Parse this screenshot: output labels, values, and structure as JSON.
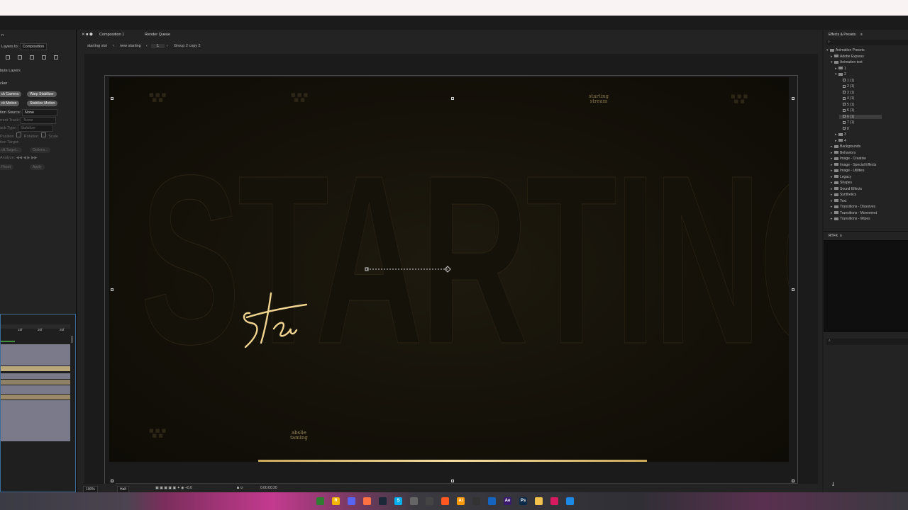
{
  "left_panel": {
    "align_label": "Layers to:",
    "align_value": "Composition",
    "distribute_label": "bute Layers",
    "tracker_title": "cker",
    "buttons": [
      "ck Camera",
      "Warp Stabilizer",
      "ck Motion",
      "Stabilize Motion"
    ],
    "motion_source_label": "tion Source:",
    "motion_source_value": "None",
    "current_track_label": "rrent Track:",
    "current_track_value": "None",
    "track_type_label": "ack Type:",
    "track_type_value": "Stabilize",
    "position_label": "Position",
    "rotation_label": "Rotation",
    "scale_label": "Scale",
    "motion_target_label": "tion Target:",
    "edit_target_label": "dit Target...",
    "options_label": "Options...",
    "analyze_label": "Analyze:",
    "reset_label": "Reset",
    "apply_label": "Apply",
    "timeline_ticks": [
      "15f",
      "20f",
      "25f"
    ]
  },
  "comp": {
    "tabs": [
      "Composition 1",
      "Render Queue"
    ],
    "breadcrumbs": [
      "starting stsi",
      "new starting",
      "1",
      "Group 2 copy 2"
    ],
    "canvas_word": "STARTING",
    "signature": "sta",
    "logo_top_right": [
      "starting",
      "stream"
    ],
    "logo_bottom_center": [
      "abslie",
      "taming"
    ],
    "view_zoom": "100%",
    "view_resolution": "Half",
    "view_timecode": "0:00:00:20"
  },
  "effects": {
    "title": "Effects & Presets",
    "search_placeholder": "",
    "tree": [
      {
        "label": "Animation Presets",
        "level": 0,
        "kind": "folder",
        "open": true
      },
      {
        "label": "Adobe Express",
        "level": 1,
        "kind": "folder",
        "open": false
      },
      {
        "label": "Animation text",
        "level": 1,
        "kind": "folder",
        "open": true
      },
      {
        "label": "1",
        "level": 2,
        "kind": "folder",
        "open": false
      },
      {
        "label": "2",
        "level": 2,
        "kind": "folder",
        "open": true
      },
      {
        "label": "1 (1)",
        "level": 3,
        "kind": "preset"
      },
      {
        "label": "2 (1)",
        "level": 3,
        "kind": "preset"
      },
      {
        "label": "3 (1)",
        "level": 3,
        "kind": "preset"
      },
      {
        "label": "4 (1)",
        "level": 3,
        "kind": "preset"
      },
      {
        "label": "5 (1)",
        "level": 3,
        "kind": "preset"
      },
      {
        "label": "6 (1)",
        "level": 3,
        "kind": "preset"
      },
      {
        "label": "6 (1)",
        "level": 3,
        "kind": "preset",
        "selected": true
      },
      {
        "label": "7 (1)",
        "level": 3,
        "kind": "preset"
      },
      {
        "label": "8",
        "level": 3,
        "kind": "preset"
      },
      {
        "label": "3",
        "level": 2,
        "kind": "folder",
        "open": false
      },
      {
        "label": "4",
        "level": 2,
        "kind": "folder",
        "open": false
      },
      {
        "label": "Backgrounds",
        "level": 1,
        "kind": "folder",
        "open": false
      },
      {
        "label": "Behaviors",
        "level": 1,
        "kind": "folder",
        "open": false
      },
      {
        "label": "Image - Creative",
        "level": 1,
        "kind": "folder",
        "open": false
      },
      {
        "label": "Image - Special Effects",
        "level": 1,
        "kind": "folder",
        "open": false
      },
      {
        "label": "Image - Utilities",
        "level": 1,
        "kind": "folder",
        "open": false
      },
      {
        "label": "Legacy",
        "level": 1,
        "kind": "folder",
        "open": false
      },
      {
        "label": "Shapes",
        "level": 1,
        "kind": "folder",
        "open": false
      },
      {
        "label": "Sound Effects",
        "level": 1,
        "kind": "folder",
        "open": false
      },
      {
        "label": "Synthetics",
        "level": 1,
        "kind": "folder",
        "open": false
      },
      {
        "label": "Text",
        "level": 1,
        "kind": "folder",
        "open": false
      },
      {
        "label": "Transitions - Dissolves",
        "level": 1,
        "kind": "folder",
        "open": false
      },
      {
        "label": "Transitions - Movement",
        "level": 1,
        "kind": "folder",
        "open": false
      },
      {
        "label": "Transitions - Wipes",
        "level": 1,
        "kind": "folder",
        "open": false
      }
    ],
    "rtfx_title": "RTFX"
  },
  "taskbar": {
    "icons": [
      "chrome-icon",
      "app-r-icon",
      "discord-icon",
      "app-orange-icon",
      "steam-icon",
      "skype-icon",
      "clock-icon",
      "obs-icon",
      "fire-icon",
      "ai-icon",
      "obs2-icon",
      "app-blue-icon",
      "ae-icon",
      "ps-icon",
      "folder-icon",
      "app-colorful-icon",
      "windows-icon"
    ],
    "labels": [
      "",
      "R",
      "",
      "",
      "",
      "S",
      "",
      "",
      "",
      "Ai",
      "",
      "",
      "Ae",
      "Ps",
      "",
      "",
      ""
    ]
  }
}
